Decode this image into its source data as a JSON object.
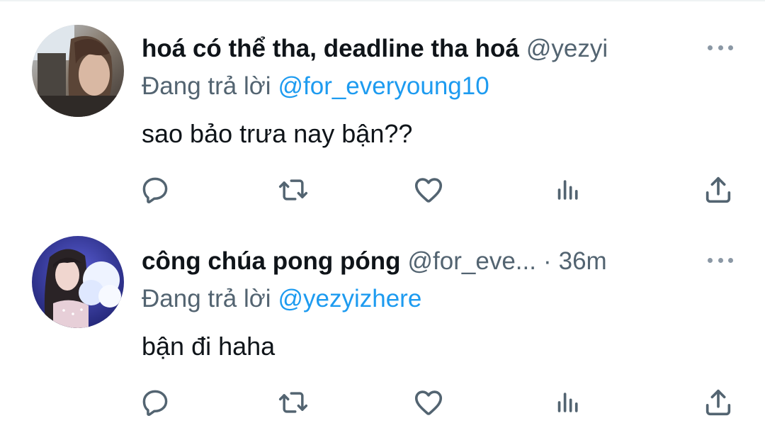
{
  "tweets": [
    {
      "display_name": "hoá có thể tha, deadline tha hoá",
      "handle": "@yezyi",
      "dot": "",
      "time": "",
      "reply_prefix": "Đang trả lời",
      "reply_to": "@for_everyoung10",
      "text": "sao bảo trưa nay bận??",
      "avatar_icon": "avatar-photo-girl-dark-hair"
    },
    {
      "display_name": "công chúa pong póng",
      "handle": "@for_eve...",
      "dot": "·",
      "time": "36m",
      "reply_prefix": "Đang trả lời",
      "reply_to": "@yezyizhere",
      "text": "bận đi haha",
      "avatar_icon": "avatar-photo-girl-cotton-candy"
    }
  ],
  "icons": {
    "more": "more-dots-icon",
    "reply": "reply-bubble-icon",
    "retweet": "retweet-icon",
    "like": "heart-icon",
    "views": "views-bars-icon",
    "share": "share-upload-icon"
  },
  "colors": {
    "text_primary": "#0f1419",
    "text_secondary": "#536471",
    "link": "#1d9bf0",
    "icon": "#536471",
    "divider": "#eff3f4"
  }
}
